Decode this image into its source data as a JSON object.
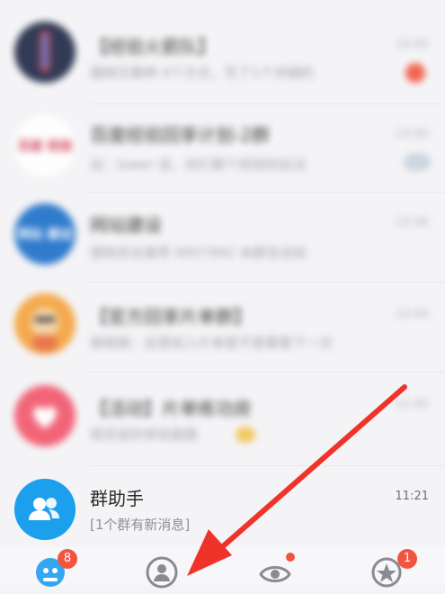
{
  "chats": [
    {
      "title": "【经验火箭队】",
      "preview": "捆绑文案种 4个方式，写了1个详细的",
      "time": "14:02",
      "badge": "dot"
    },
    {
      "title": "百度经验回享计划-2群",
      "preview": "站：lower 说，你们那个经验的玩法",
      "time": "13:50",
      "badge": "muted"
    },
    {
      "title": "网站建设",
      "preview": "搜狗优化推荐 8957992 本群告诉前",
      "time": "13:56",
      "badge": ""
    },
    {
      "title": "【官方回享片单群】",
      "preview": "朋朋朋：这里如入片单是不是要看下一次",
      "time": "13:43",
      "badge": ""
    },
    {
      "title": "【活动】片单练功房",
      "preview": "规范说的体验面图",
      "time": "11:42",
      "badge": "emoji"
    },
    {
      "title": "群助手",
      "preview": "[1个群有新消息]",
      "time": "11:21",
      "badge": ""
    }
  ],
  "avatars": {
    "a1_text": "",
    "a2_text": "百度 经验",
    "a3_text": "网站 建设"
  },
  "tabs": {
    "messages_badge": "8",
    "qzone_badge": "1"
  },
  "colors": {
    "accent": "#1c9bf0",
    "badge_red": "#f1553f",
    "arrow_red": "#f0332a"
  }
}
